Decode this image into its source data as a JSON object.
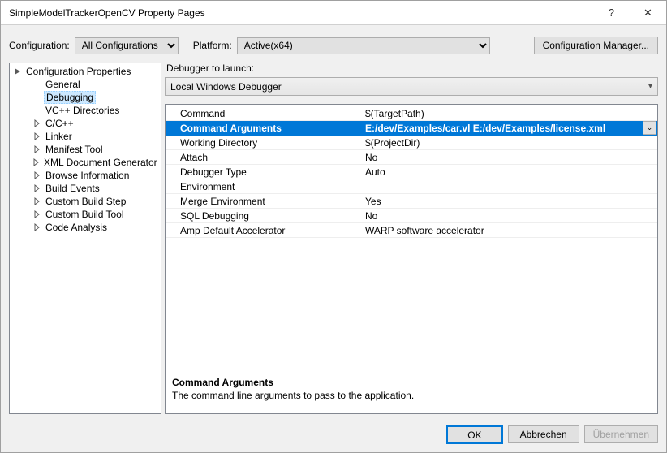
{
  "titlebar": {
    "title": "SimpleModelTrackerOpenCV Property Pages",
    "help": "?",
    "close": "✕"
  },
  "config": {
    "config_label": "Configuration:",
    "config_value": "All Configurations",
    "platform_label": "Platform:",
    "platform_value": "Active(x64)",
    "manager_btn": "Configuration Manager..."
  },
  "tree": {
    "root": "Configuration Properties",
    "items": [
      {
        "label": "General",
        "expander": "none",
        "indent": 42
      },
      {
        "label": "Debugging",
        "expander": "none",
        "indent": 42,
        "selected": true
      },
      {
        "label": "VC++ Directories",
        "expander": "none",
        "indent": 42
      },
      {
        "label": "C/C++",
        "expander": "closed",
        "indent": 28
      },
      {
        "label": "Linker",
        "expander": "closed",
        "indent": 28
      },
      {
        "label": "Manifest Tool",
        "expander": "closed",
        "indent": 28
      },
      {
        "label": "XML Document Generator",
        "expander": "closed",
        "indent": 28
      },
      {
        "label": "Browse Information",
        "expander": "closed",
        "indent": 28
      },
      {
        "label": "Build Events",
        "expander": "closed",
        "indent": 28
      },
      {
        "label": "Custom Build Step",
        "expander": "closed",
        "indent": 28
      },
      {
        "label": "Custom Build Tool",
        "expander": "closed",
        "indent": 28
      },
      {
        "label": "Code Analysis",
        "expander": "closed",
        "indent": 28
      }
    ]
  },
  "launch": {
    "label": "Debugger to launch:",
    "value": "Local Windows Debugger"
  },
  "props": [
    {
      "name": "Command",
      "value": "$(TargetPath)"
    },
    {
      "name": "Command Arguments",
      "value": "E:/dev/Examples/car.vl E:/dev/Examples/license.xml",
      "selected": true
    },
    {
      "name": "Working Directory",
      "value": "$(ProjectDir)"
    },
    {
      "name": "Attach",
      "value": "No"
    },
    {
      "name": "Debugger Type",
      "value": "Auto"
    },
    {
      "name": "Environment",
      "value": ""
    },
    {
      "name": "Merge Environment",
      "value": "Yes"
    },
    {
      "name": "SQL Debugging",
      "value": "No"
    },
    {
      "name": "Amp Default Accelerator",
      "value": "WARP software accelerator"
    }
  ],
  "desc": {
    "title": "Command Arguments",
    "text": "The command line arguments to pass to the application."
  },
  "buttons": {
    "ok": "OK",
    "cancel": "Abbrechen",
    "apply": "Übernehmen"
  }
}
